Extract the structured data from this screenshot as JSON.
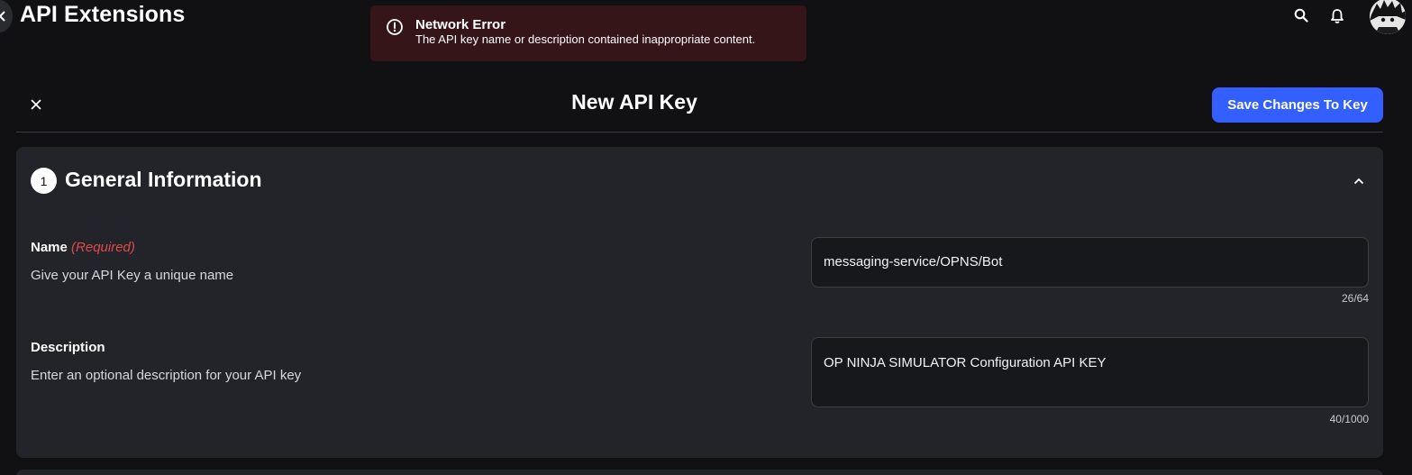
{
  "header": {
    "app_title": "API Extensions",
    "back_icon": "chevron-left-icon",
    "search_icon": "search-icon",
    "notifications_icon": "bell-icon",
    "avatar_icon": "avatar"
  },
  "toast": {
    "icon": "alert-circle-icon",
    "title": "Network Error",
    "message": "The API key name or description contained inappropriate content."
  },
  "page": {
    "title": "New API Key",
    "close_icon": "close-icon",
    "save_label": "Save Changes To Key",
    "accent_color": "#335fff"
  },
  "section": {
    "step": "1",
    "title": "General Information",
    "collapse_icon": "chevron-up-icon"
  },
  "fields": {
    "name": {
      "label": "Name",
      "required": "(Required)",
      "help": "Give your API Key a unique name",
      "value": "messaging-service/OPNS/Bot",
      "counter": "26/64"
    },
    "description": {
      "label": "Description",
      "help": "Enter an optional description for your API key",
      "value": "OP NINJA SIMULATOR Configuration API KEY",
      "counter": "40/1000"
    }
  }
}
